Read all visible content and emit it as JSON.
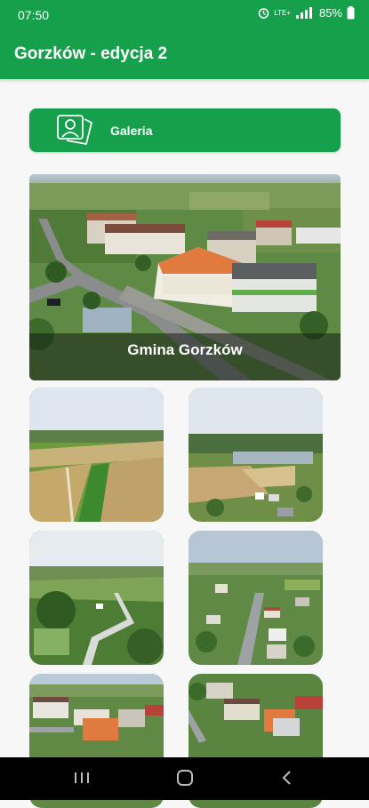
{
  "status_bar": {
    "time": "07:50",
    "network": "LTE+",
    "battery": "85%",
    "icons": [
      "alarm-icon",
      "signal-icon",
      "battery-icon"
    ]
  },
  "app_bar": {
    "title": "Gorzków - edycja 2"
  },
  "gallery_button": {
    "label": "Galeria",
    "icon": "contact-card-icon"
  },
  "hero": {
    "caption": "Gmina Gorzków"
  },
  "thumbnails": [
    {
      "name": "aerial-fields"
    },
    {
      "name": "aerial-village-ponds"
    },
    {
      "name": "aerial-crossroads"
    },
    {
      "name": "aerial-town-street"
    },
    {
      "name": "aerial-town-center"
    },
    {
      "name": "aerial-church-area"
    }
  ],
  "nav_bar": {
    "items": [
      "recent-apps-icon",
      "home-icon",
      "back-icon"
    ]
  },
  "colors": {
    "primary": "#16a04c",
    "background": "#f6f7f6",
    "nav_bar": "#000000"
  }
}
